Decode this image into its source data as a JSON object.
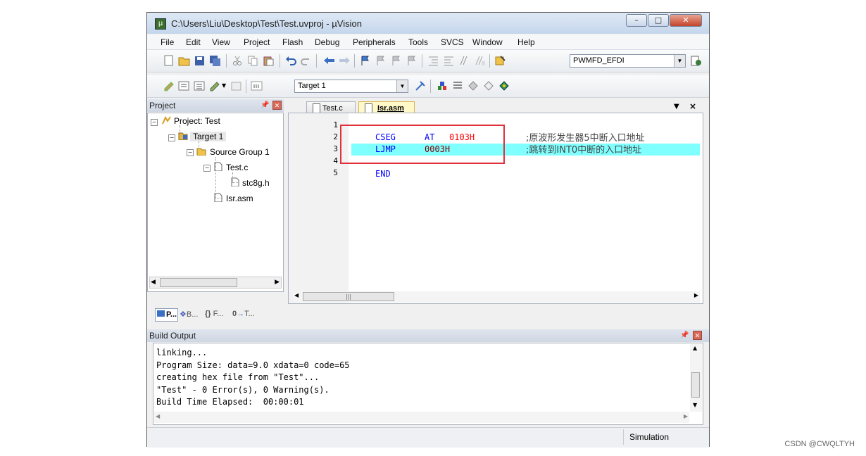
{
  "window": {
    "title": "C:\\Users\\Liu\\Desktop\\Test\\Test.uvproj - µVision"
  },
  "menu": [
    "File",
    "Edit",
    "View",
    "Project",
    "Flash",
    "Debug",
    "Peripherals",
    "Tools",
    "SVCS",
    "Window",
    "Help"
  ],
  "toolbar": {
    "device_combo": "PWMFD_EFDI",
    "target_combo": "Target 1"
  },
  "project_panel": {
    "header": "Project",
    "tree": {
      "root": "Project: Test",
      "target": "Target 1",
      "group": "Source Group 1",
      "file1": "Test.c",
      "include": "stc8g.h",
      "file2": "Isr.asm"
    },
    "tabs": [
      "P...",
      "B...",
      "F...",
      "T..."
    ]
  },
  "editor": {
    "tabs": [
      "Test.c",
      "Isr.asm"
    ],
    "active_tab": "Isr.asm",
    "line_numbers": [
      "1",
      "2",
      "3",
      "4",
      "5"
    ],
    "lines": {
      "l2": {
        "kw": "CSEG",
        "op1": "AT",
        "op2": "0103H",
        "comment": ";原波形发生器5中断入口地址"
      },
      "l3": {
        "kw": "LJMP",
        "op2": "0003H",
        "comment": ";跳转到INT0中断的入口地址"
      },
      "l5": {
        "kw": "END"
      }
    },
    "highlight_color": "#80ffff",
    "keyword_color": "#0000ff",
    "number_color": "#ff0000",
    "annotation_box_color": "#e0303a"
  },
  "build_output": {
    "header": "Build Output",
    "lines": [
      "linking...",
      "Program Size: data=9.0 xdata=0 code=65",
      "creating hex file from \"Test\"...",
      "\"Test\" - 0 Error(s), 0 Warning(s).",
      "Build Time Elapsed:  00:00:01"
    ]
  },
  "status": {
    "mode": "Simulation"
  },
  "watermark": "CSDN @CWQLTYH"
}
